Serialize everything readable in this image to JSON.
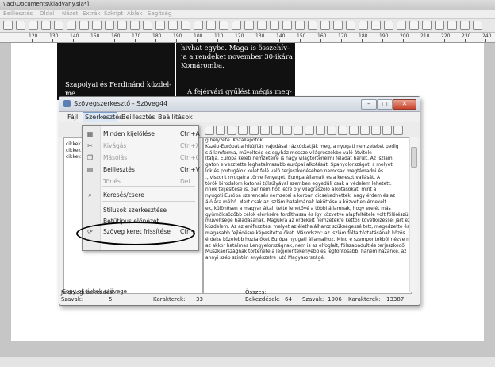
{
  "window": {
    "title": "\\laci\\Documents\\kiadvany.sla*]",
    "menu": [
      "Beillesztés",
      "Oldal",
      "Nézet",
      "Extrák",
      "Szkript",
      "Ablak",
      "Segítség"
    ]
  },
  "ruler_ticks": [
    "120",
    "130",
    "140",
    "150",
    "160",
    "170",
    "180",
    "190",
    "100",
    "110",
    "120",
    "130",
    "140",
    "150",
    "160",
    "170",
    "180",
    "190",
    "200",
    "210",
    "220",
    "230",
    "240"
  ],
  "document": {
    "left_text": [
      "Szapolyai és Ferdinánd küzdel-",
      "me."
    ],
    "right_text": [
      "hivhat egybe. Maga is összehív-",
      "ja a rendeket november 30-ikára",
      "Komáromba.",
      "",
      "A fejérvári gyűlést mégis meg-"
    ]
  },
  "dialog": {
    "title": "Szövegszerkesztő - Szöveg44",
    "menu": [
      "Fájl",
      "Szerkesztés",
      "Beillesztés",
      "Beállítások"
    ],
    "left_items": [
      "cikkek",
      "cikkek",
      "cikkek"
    ],
    "text_lines": [
      "g helyzete. Közállapotok.",
      "",
      "Kszép-Európát a hitújítás vajúdásai rázkódtatják meg, a nyugati nemzeteket pedig",
      "s államforma, műveltség és egyház messze világrészekbe való átvitele",
      "ltatja. Európa keleti nemzeteire is nagy világtörténelmi feladat hárult. Az iszlám,",
      "gaton elvesztette leghatalmasabb európai alkotását, Spanyolországot, s melyet",
      "lok és portugálok kelet felé való terjeszkedésében nemcsak megtámadni és",
      "., viszont nyugatra törve fenyegeti Európa államait és a kereszt vallását. A",
      "török birodalom katonai túlsúlyával szemben egyedüli csak a védelem lehetett.",
      "nnek teljesítése is, bár nem hoz létre oly világraszóló alkotásokat, mint a",
      "nyugoti Európa szerencsés nemzetei a korban dicsekedhettek, nagy érdem és az",
      "álójára méltó. Mert csak az iszlám hatalmának leköttése a közvetlen érdekelt",
      "ek, különösen a magyar által, tette lehetővé a többi államnak, hogy erejét más",
      "gyümölcsözőbb célok elérésére fordíthassa és így közvetve alapfeltétele volt fölérészünk",
      "műveltségé haladásának. Magukra az érdekelt nemzetekre kettős következéssel járt ez a",
      "küzdelem. Az az erőfeszítés, melyet az élethalálharcz szükségessé tett, megedzette és",
      "magasabb fejlődésre képesítette őket. Másodszor: az iszlám föltartóztatásának közös",
      "érdeke közelebb hozta őket Európa nyugati államaihoz. Mind e szempontokból nézve nem",
      "az akkor hatalmas Lengyelországnak, nem is az elfoglalt, fölszabadult és terjeszkedő",
      "Muszkaországnak története a legjelentékenyebb és legfontosabb, hanem hazánké, az",
      "annyi szép szintén enyészetre jutó Magyarországé."
    ],
    "copy_label": "Copy of cikkek szövege",
    "status": {
      "current_paragraph_label": "Jelenlegi bekezdés:",
      "total_label": "Összes:",
      "words_label": "Szavak:",
      "words_value": "5",
      "chars_label": "Karakterek:",
      "chars_value": "33",
      "paragraphs_label": "Bekezdések:",
      "paragraphs_value": "64",
      "total_words_label": "Szavak:",
      "total_words_value": "1906",
      "total_chars_label": "Karakterek:",
      "total_chars_value": "13387"
    }
  },
  "edit_menu": {
    "items": [
      {
        "icon": "select-all-icon",
        "label": "Minden kijelölése",
        "shortcut": "Ctrl+A",
        "disabled": false
      },
      {
        "icon": "cut-icon",
        "label": "Kivágás",
        "shortcut": "Ctrl+X",
        "disabled": true
      },
      {
        "icon": "copy-icon",
        "label": "Másolás",
        "shortcut": "Ctrl+C",
        "disabled": true
      },
      {
        "icon": "paste-icon",
        "label": "Beillesztés",
        "shortcut": "Ctrl+V",
        "disabled": false
      },
      {
        "icon": "delete-icon",
        "label": "Törlés",
        "shortcut": "Del",
        "disabled": true
      },
      {
        "icon": "search-icon",
        "label": "Keresés/csere",
        "shortcut": "",
        "disabled": false
      },
      {
        "icon": "",
        "label": "Stílusok szerkesztése",
        "shortcut": "",
        "disabled": false
      },
      {
        "icon": "",
        "label": "Betűtípus előnézet",
        "shortcut": "",
        "disabled": false
      },
      {
        "icon": "refresh-icon",
        "label": "Szöveg keret frissítése",
        "shortcut": "Ctrl+",
        "disabled": false
      }
    ]
  }
}
